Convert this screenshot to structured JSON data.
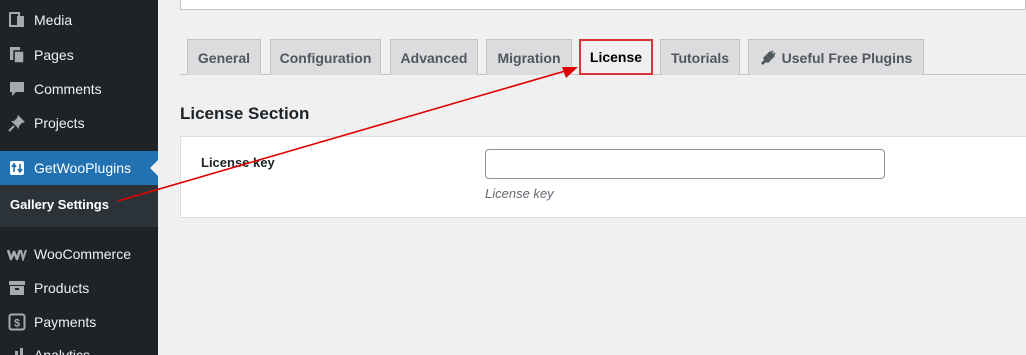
{
  "sidebar": {
    "items": [
      {
        "label": "Media",
        "icon": "media-icon"
      },
      {
        "label": "Pages",
        "icon": "pages-icon"
      },
      {
        "label": "Comments",
        "icon": "comments-icon"
      },
      {
        "label": "Projects",
        "icon": "pin-icon"
      },
      {
        "label": "GetWooPlugins",
        "icon": "getwooplugins-icon",
        "active": true
      },
      {
        "label": "WooCommerce",
        "icon": "woocommerce-icon"
      },
      {
        "label": "Products",
        "icon": "products-icon"
      },
      {
        "label": "Payments",
        "icon": "payments-icon"
      },
      {
        "label": "Analytics",
        "icon": "analytics-icon"
      }
    ],
    "submenu": {
      "label": "Gallery Settings"
    }
  },
  "tabs": [
    {
      "label": "General"
    },
    {
      "label": "Configuration"
    },
    {
      "label": "Advanced"
    },
    {
      "label": "Migration"
    },
    {
      "label": "License",
      "active": true
    },
    {
      "label": "Tutorials"
    },
    {
      "label": "Useful Free Plugins",
      "icon": "plug-icon"
    }
  ],
  "section": {
    "title": "License Section",
    "field": {
      "label": "License key",
      "value": "",
      "placeholder": "",
      "description": "License key"
    }
  },
  "colors": {
    "sidebar_bg": "#1d2327",
    "active_menu": "#2271b1",
    "annotation_red": "#e00000"
  }
}
